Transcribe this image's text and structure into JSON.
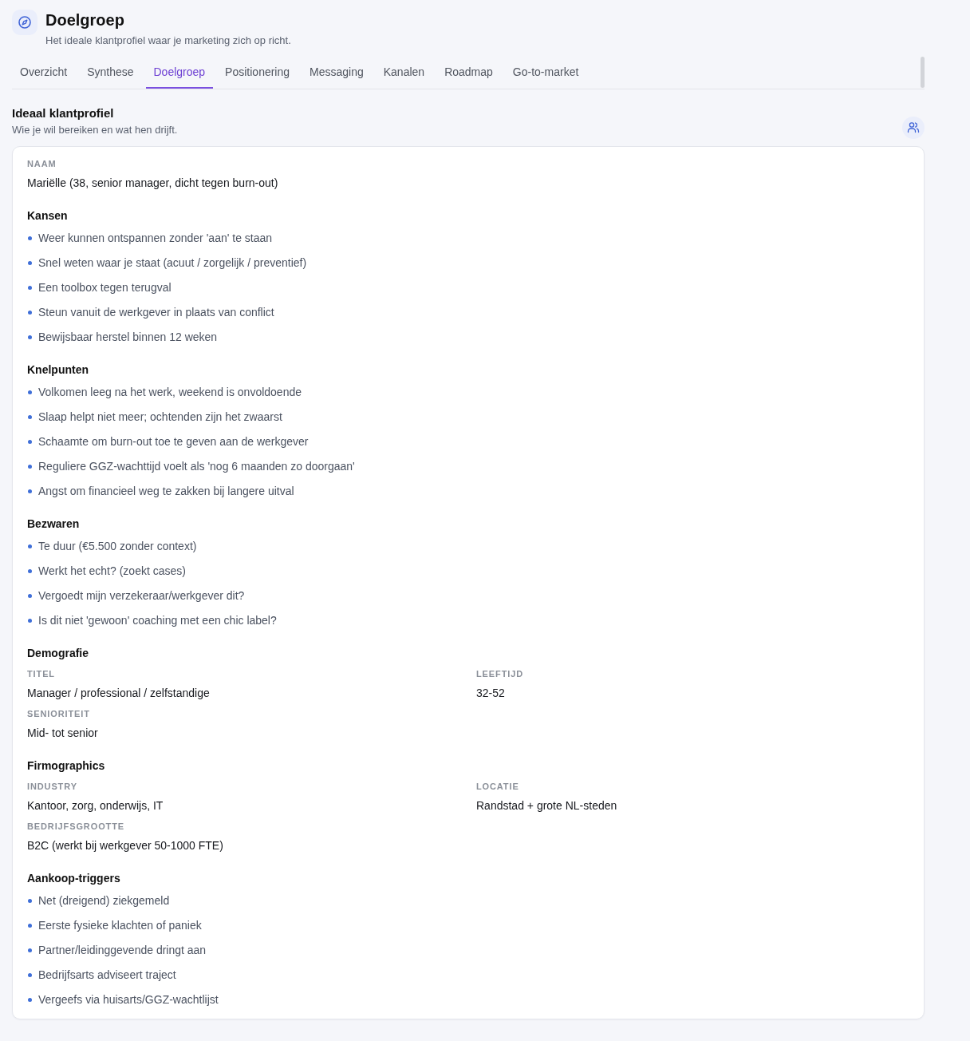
{
  "header": {
    "title": "Doelgroep",
    "subtitle": "Het ideale klantprofiel waar je marketing zich op richt."
  },
  "tabs": [
    {
      "label": "Overzicht",
      "selected": false
    },
    {
      "label": "Synthese",
      "selected": false
    },
    {
      "label": "Doelgroep",
      "selected": true
    },
    {
      "label": "Positionering",
      "selected": false
    },
    {
      "label": "Messaging",
      "selected": false
    },
    {
      "label": "Kanalen",
      "selected": false
    },
    {
      "label": "Roadmap",
      "selected": false
    },
    {
      "label": "Go-to-market",
      "selected": false
    }
  ],
  "section": {
    "title": "Ideaal klantprofiel",
    "subtitle": "Wie je wil bereiken en wat hen drijft."
  },
  "profile": {
    "blocks": [
      {
        "kind": "field",
        "label": "NAAM",
        "value": "Mariëlle (38, senior manager, dicht tegen burn-out)"
      },
      {
        "kind": "list",
        "heading": "Kansen",
        "items": [
          "Weer kunnen ontspannen zonder 'aan' te staan",
          "Snel weten waar je staat (acuut / zorgelijk / preventief)",
          "Een toolbox tegen terugval",
          "Steun vanuit de werkgever in plaats van conflict",
          "Bewijsbaar herstel binnen 12 weken"
        ]
      },
      {
        "kind": "list",
        "heading": "Knelpunten",
        "items": [
          "Volkomen leeg na het werk, weekend is onvoldoende",
          "Slaap helpt niet meer; ochtenden zijn het zwaarst",
          "Schaamte om burn-out toe te geven aan de werkgever",
          "Reguliere GGZ-wachttijd voelt als 'nog 6 maanden zo doorgaan'",
          "Angst om financieel weg te zakken bij langere uitval"
        ]
      },
      {
        "kind": "list",
        "heading": "Bezwaren",
        "items": [
          "Te duur (€5.500 zonder context)",
          "Werkt het echt? (zoekt cases)",
          "Vergoedt mijn verzekeraar/werkgever dit?",
          "Is dit niet 'gewoon' coaching met een chic label?"
        ]
      },
      {
        "kind": "grid",
        "heading": "Demografie",
        "fields": [
          {
            "label": "TITEL",
            "value": "Manager / professional / zelfstandige"
          },
          {
            "label": "LEEFTIJD",
            "value": "32-52"
          },
          {
            "label": "SENIORITEIT",
            "value": "Mid- tot senior"
          }
        ]
      },
      {
        "kind": "grid",
        "heading": "Firmographics",
        "fields": [
          {
            "label": "INDUSTRY",
            "value": "Kantoor, zorg, onderwijs, IT"
          },
          {
            "label": "LOCATIE",
            "value": "Randstad + grote NL-steden"
          },
          {
            "label": "BEDRIJFSGROOTTE",
            "value": "B2C (werkt bij werkgever 50-1000 FTE)"
          }
        ]
      },
      {
        "kind": "list",
        "heading": "Aankoop-triggers",
        "items": [
          "Net (dreigend) ziekgemeld",
          "Eerste fysieke klachten of paniek",
          "Partner/leidinggevende dringt aan",
          "Bedrijfsarts adviseert traject",
          "Vergeefs via huisarts/GGZ-wachtlijst"
        ]
      }
    ]
  }
}
